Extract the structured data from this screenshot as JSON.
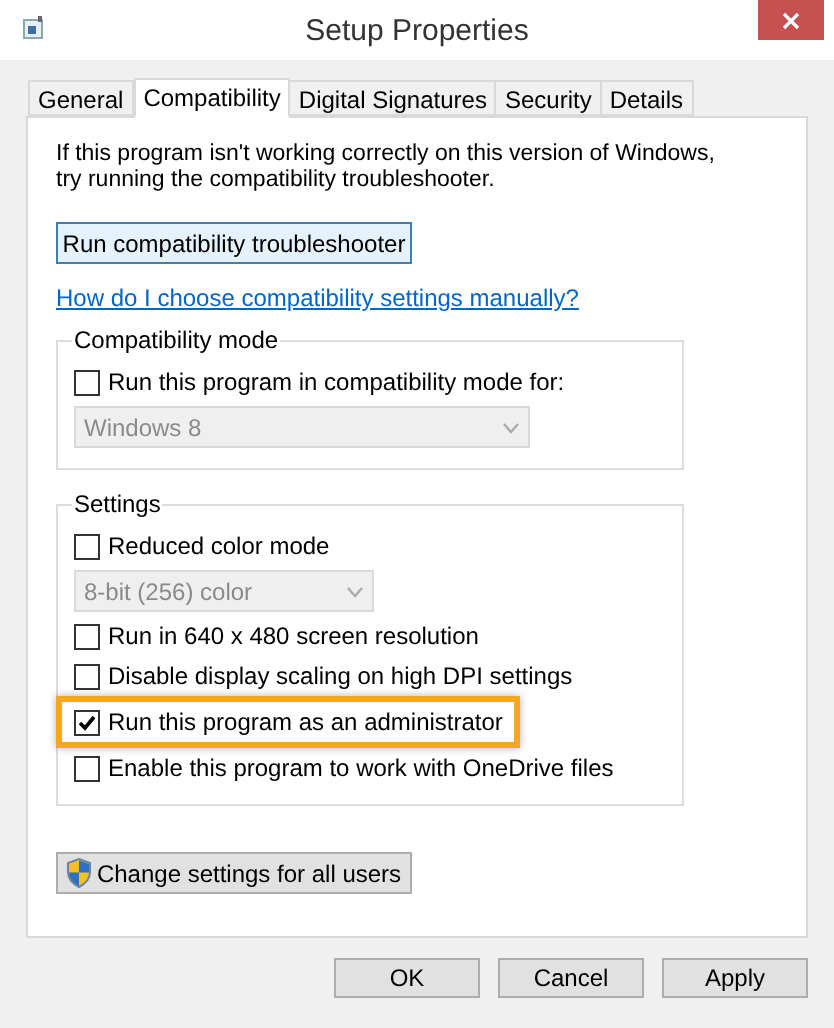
{
  "window": {
    "title": "Setup Properties"
  },
  "tabs": [
    {
      "label": "General",
      "selected": false
    },
    {
      "label": "Compatibility",
      "selected": true
    },
    {
      "label": "Digital Signatures",
      "selected": false
    },
    {
      "label": "Security",
      "selected": false
    },
    {
      "label": "Details",
      "selected": false
    }
  ],
  "intro": "If this program isn't working correctly on this version of Windows, try running the compatibility troubleshooter.",
  "troubleshooter_button": "Run compatibility troubleshooter",
  "help_link": "How do I choose compatibility settings manually?",
  "groups": [
    {
      "title": "Compatibility mode",
      "items": [
        {
          "kind": "checkbox",
          "label": "Run this program in compatibility mode for:",
          "checked": false,
          "highlighted": false
        },
        {
          "kind": "dropdown",
          "value": "Windows 8",
          "disabled": true,
          "wide": true
        }
      ]
    },
    {
      "title": "Settings",
      "items": [
        {
          "kind": "checkbox",
          "label": "Reduced color mode",
          "checked": false,
          "highlighted": false
        },
        {
          "kind": "dropdown",
          "value": "8-bit (256) color",
          "disabled": true,
          "wide": false
        },
        {
          "kind": "checkbox",
          "label": "Run in 640 x 480 screen resolution",
          "checked": false,
          "highlighted": false
        },
        {
          "kind": "checkbox",
          "label": "Disable display scaling on high DPI settings",
          "checked": false,
          "highlighted": false
        },
        {
          "kind": "checkbox",
          "label": "Run this program as an administrator",
          "checked": true,
          "highlighted": true
        },
        {
          "kind": "checkbox",
          "label": "Enable this program to work with OneDrive files",
          "checked": false,
          "highlighted": false
        }
      ]
    }
  ],
  "all_users_button": "Change settings for all users",
  "buttons": [
    "OK",
    "Cancel",
    "Apply"
  ]
}
